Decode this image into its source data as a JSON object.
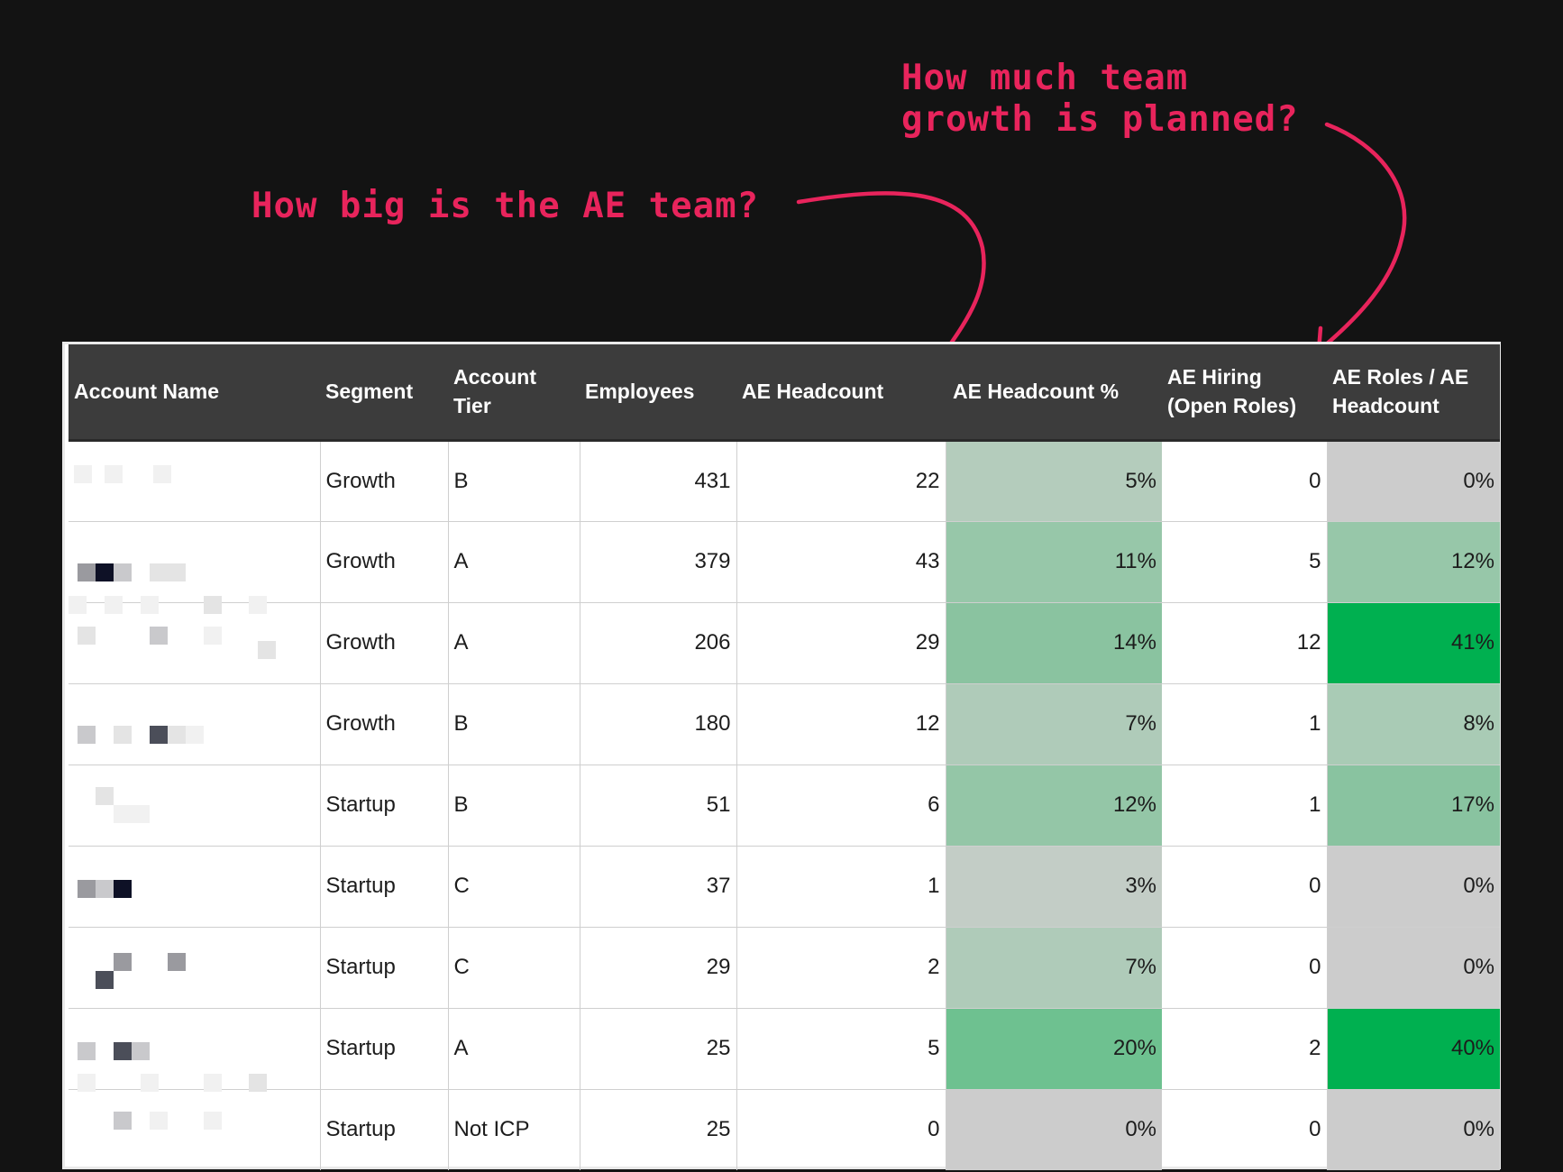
{
  "annotations": {
    "ae_team": "How big is the AE team?",
    "growth": "How much team\ngrowth is planned?"
  },
  "colors": {
    "background": "#131313",
    "annotation": "#e8245c",
    "header_bg": "#3c3c3c"
  },
  "table": {
    "headers": {
      "account_name": "Account Name",
      "segment": "Segment",
      "account_tier": "Account Tier",
      "employees": "Employees",
      "ae_headcount": "AE Headcount",
      "ae_headcount_pct": "AE Headcount %",
      "ae_hiring": "AE Hiring (Open Roles)",
      "ae_roles_ratio": "AE Roles / AE Headcount"
    },
    "rows": [
      {
        "segment": "Growth",
        "tier": "B",
        "employees": "431",
        "ae_headcount": "22",
        "ae_headcount_pct": "5%",
        "pct_color": "#b4ccbc",
        "open_roles": "0",
        "ratio": "0%",
        "ratio_color": "#cccccc"
      },
      {
        "segment": "Growth",
        "tier": "A",
        "employees": "379",
        "ae_headcount": "43",
        "ae_headcount_pct": "11%",
        "pct_color": "#97c7a9",
        "open_roles": "5",
        "ratio": "12%",
        "ratio_color": "#97c7a9"
      },
      {
        "segment": "Growth",
        "tier": "A",
        "employees": "206",
        "ae_headcount": "29",
        "ae_headcount_pct": "14%",
        "pct_color": "#8ac3a0",
        "open_roles": "12",
        "ratio": "41%",
        "ratio_color": "#00b050"
      },
      {
        "segment": "Growth",
        "tier": "B",
        "employees": "180",
        "ae_headcount": "12",
        "ae_headcount_pct": "7%",
        "pct_color": "#afcbb9",
        "open_roles": "1",
        "ratio": "8%",
        "ratio_color": "#a9cbb5"
      },
      {
        "segment": "Startup",
        "tier": "B",
        "employees": "51",
        "ae_headcount": "6",
        "ae_headcount_pct": "12%",
        "pct_color": "#94c6a7",
        "open_roles": "1",
        "ratio": "17%",
        "ratio_color": "#89c3a0"
      },
      {
        "segment": "Startup",
        "tier": "C",
        "employees": "37",
        "ae_headcount": "1",
        "ae_headcount_pct": "3%",
        "pct_color": "#c3cdc6",
        "open_roles": "0",
        "ratio": "0%",
        "ratio_color": "#cccccc"
      },
      {
        "segment": "Startup",
        "tier": "C",
        "employees": "29",
        "ae_headcount": "2",
        "ae_headcount_pct": "7%",
        "pct_color": "#afcbb9",
        "open_roles": "0",
        "ratio": "0%",
        "ratio_color": "#cccccc"
      },
      {
        "segment": "Startup",
        "tier": "A",
        "employees": "25",
        "ae_headcount": "5",
        "ae_headcount_pct": "20%",
        "pct_color": "#6ec190",
        "open_roles": "2",
        "ratio": "40%",
        "ratio_color": "#00b050"
      },
      {
        "segment": "Startup",
        "tier": "Not ICP",
        "employees": "25",
        "ae_headcount": "0",
        "ae_headcount_pct": "0%",
        "pct_color": "#cccccc",
        "open_roles": "0",
        "ratio": "0%",
        "ratio_color": "#cccccc"
      }
    ]
  }
}
